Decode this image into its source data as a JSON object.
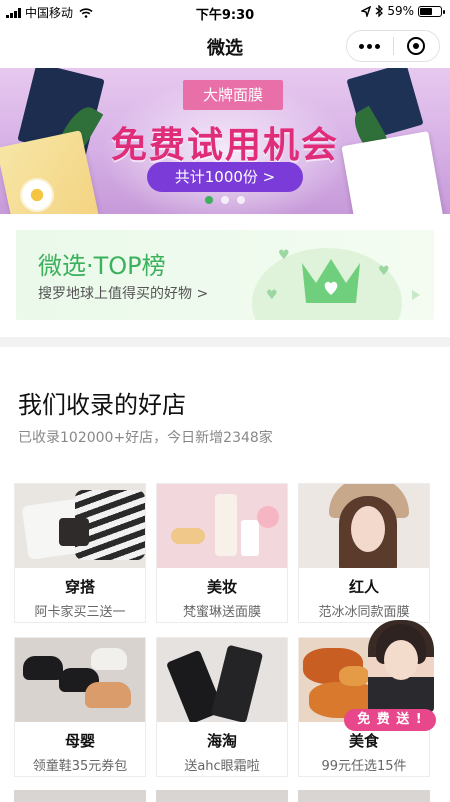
{
  "status_bar": {
    "carrier": "中国移动",
    "time": "下午9:30",
    "battery": "59%",
    "battery_level": 0.59,
    "icons": [
      "signal-icon",
      "wifi-icon",
      "location-icon",
      "bluetooth-icon",
      "battery-icon"
    ]
  },
  "nav": {
    "title": "微选",
    "more_icon": "more-dots-icon",
    "close_icon": "close-circle-icon"
  },
  "banner": {
    "tag": "大牌面膜",
    "title": "免费试用机会",
    "button": "共计1000份 >",
    "slides": 3,
    "active_slide": 1,
    "accent": "#e02d7a",
    "button_color": "#7a3bd8"
  },
  "top_list": {
    "title": "微选·TOP榜",
    "subtitle": "搜罗地球上值得买的好物 >",
    "accent": "#3bb15c"
  },
  "shops_section": {
    "title": "我们收录的好店",
    "subtitle": "已收录102000+好店，今日新增2348家",
    "items": [
      {
        "name": "穿搭",
        "desc": "阿卡家买三送一"
      },
      {
        "name": "美妆",
        "desc": "梵蜜琳送面膜"
      },
      {
        "name": "红人",
        "desc": "范冰冰同款面膜"
      },
      {
        "name": "母婴",
        "desc": "领童鞋35元券包"
      },
      {
        "name": "海淘",
        "desc": "送ahc眼霜啦"
      },
      {
        "name": "美食",
        "desc": "99元任选15件"
      }
    ]
  },
  "promo": {
    "badge": "免 费 送 !",
    "badge_color": "#e8478b"
  }
}
